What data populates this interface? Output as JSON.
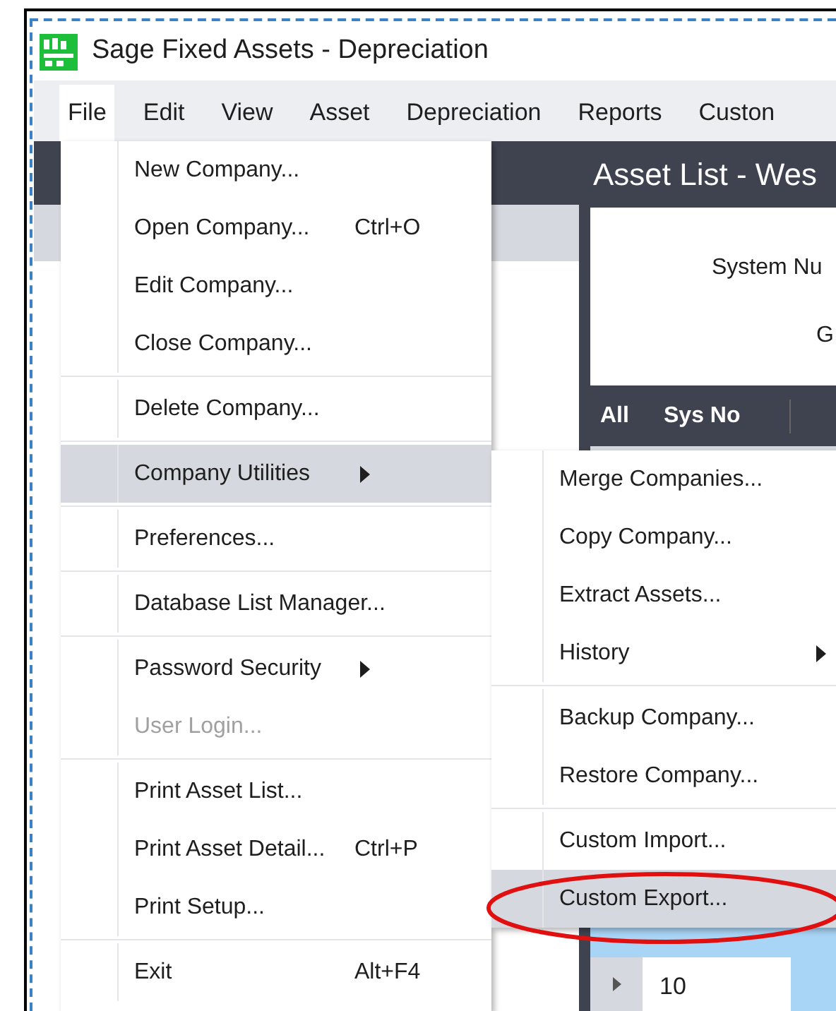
{
  "window": {
    "title": "Sage Fixed Assets - Depreciation"
  },
  "menu_bar": [
    {
      "label": "File",
      "selected": true
    },
    {
      "label": "Edit",
      "selected": false
    },
    {
      "label": "View",
      "selected": false
    },
    {
      "label": "Asset",
      "selected": false
    },
    {
      "label": "Depreciation",
      "selected": false
    },
    {
      "label": "Reports",
      "selected": false
    },
    {
      "label": "Custon",
      "selected": false
    }
  ],
  "asset_list": {
    "title": "Asset List - Wes",
    "fields": [
      "System Nu",
      "G"
    ],
    "columns": [
      "All",
      "Sys No"
    ],
    "rows": [
      "10"
    ]
  },
  "file_menu": [
    {
      "kind": "item",
      "label": "New Company...",
      "selected": false,
      "disabled": false
    },
    {
      "kind": "item",
      "label": "Open Company...",
      "shortcut": "Ctrl+O",
      "selected": false,
      "disabled": false
    },
    {
      "kind": "item",
      "label": "Edit Company...",
      "selected": false,
      "disabled": false
    },
    {
      "kind": "item",
      "label": "Close Company...",
      "selected": false,
      "disabled": false
    },
    {
      "kind": "separator"
    },
    {
      "kind": "item",
      "label": "Delete Company...",
      "selected": false,
      "disabled": false
    },
    {
      "kind": "separator"
    },
    {
      "kind": "submenu",
      "label": "Company Utilities",
      "selected": true,
      "disabled": false
    },
    {
      "kind": "separator"
    },
    {
      "kind": "item",
      "label": "Preferences...",
      "selected": false,
      "disabled": false
    },
    {
      "kind": "separator"
    },
    {
      "kind": "item",
      "label": "Database List Manager...",
      "selected": false,
      "disabled": false
    },
    {
      "kind": "separator"
    },
    {
      "kind": "submenu",
      "label": "Password Security",
      "selected": false,
      "disabled": false
    },
    {
      "kind": "item",
      "label": "User Login...",
      "selected": false,
      "disabled": true
    },
    {
      "kind": "separator"
    },
    {
      "kind": "item",
      "label": "Print Asset List...",
      "selected": false,
      "disabled": false
    },
    {
      "kind": "item",
      "label": "Print Asset Detail...",
      "shortcut": "Ctrl+P",
      "selected": false,
      "disabled": false
    },
    {
      "kind": "item",
      "label": "Print Setup...",
      "selected": false,
      "disabled": false
    },
    {
      "kind": "separator"
    },
    {
      "kind": "item",
      "label": "Exit",
      "shortcut": "Alt+F4",
      "selected": false,
      "disabled": false
    }
  ],
  "utilities_submenu": [
    {
      "kind": "item",
      "label": "Merge Companies...",
      "selected": false,
      "disabled": false
    },
    {
      "kind": "item",
      "label": "Copy Company...",
      "selected": false,
      "disabled": false
    },
    {
      "kind": "item",
      "label": "Extract Assets...",
      "selected": false,
      "disabled": false
    },
    {
      "kind": "submenu",
      "label": "History",
      "selected": false,
      "disabled": false
    },
    {
      "kind": "separator"
    },
    {
      "kind": "item",
      "label": "Backup Company...",
      "selected": false,
      "disabled": false
    },
    {
      "kind": "item",
      "label": "Restore Company...",
      "selected": false,
      "disabled": false
    },
    {
      "kind": "separator"
    },
    {
      "kind": "item",
      "label": "Custom Import...",
      "selected": false,
      "disabled": false
    },
    {
      "kind": "item",
      "label": "Custom Export...",
      "selected": true,
      "disabled": false,
      "circled": true
    }
  ]
}
